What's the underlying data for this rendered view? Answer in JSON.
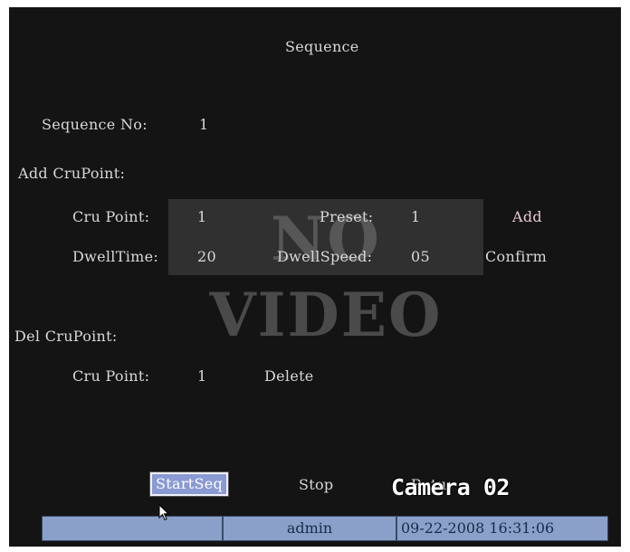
{
  "title": "Sequence",
  "sequence_no": {
    "label": "Sequence No:",
    "value": "1"
  },
  "add_section": {
    "heading": "Add CruPoint:",
    "cru_point_label": "Cru Point:",
    "cru_point_value": "1",
    "preset_label": "Preset:",
    "preset_value": "1",
    "add_label": "Add",
    "dwell_time_label": "DwellTime:",
    "dwell_time_value": "20",
    "dwell_speed_label": "DwellSpeed:",
    "dwell_speed_value": "05",
    "confirm_label": "Confirm"
  },
  "overlay": "NO VIDEO",
  "del_section": {
    "heading": "Del CruPoint:",
    "cru_point_label": "Cru Point:",
    "cru_point_value": "1",
    "delete_label": "Delete"
  },
  "buttons": {
    "start": "StartSeq",
    "stop": "Stop",
    "return": "Retur"
  },
  "camera_label": "Camera 02",
  "status_bar": {
    "user": "admin",
    "datetime": "09-22-2008 16:31:06"
  },
  "colors": {
    "background": "#141414",
    "selection": "#8a9ad2",
    "status_bar": "#8aa0c8"
  }
}
